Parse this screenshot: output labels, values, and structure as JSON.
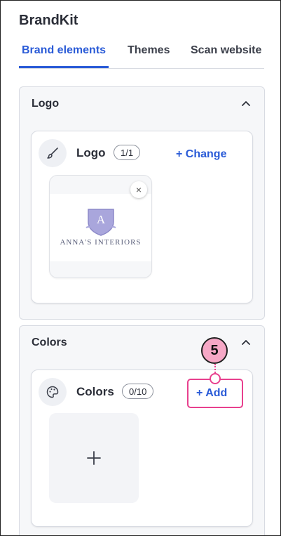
{
  "app": {
    "title": "BrandKit"
  },
  "tabs": [
    {
      "label": "Brand elements",
      "active": true
    },
    {
      "label": "Themes",
      "active": false
    },
    {
      "label": "Scan website",
      "active": false
    }
  ],
  "logo_panel": {
    "title": "Logo",
    "card": {
      "label": "Logo",
      "count": "1/1",
      "action": "+ Change",
      "logo_name": "ANNA'S INTERIORS",
      "logo_monogram": "A",
      "remove_icon": "×"
    }
  },
  "colors_panel": {
    "title": "Colors",
    "card": {
      "label": "Colors",
      "count": "0/10",
      "action": "+ Add",
      "add_tile_icon": "+"
    }
  },
  "callout": {
    "number": "5"
  },
  "colors": {
    "accent": "#2a5bd7",
    "callout": "#e8408e",
    "callout_fill": "#f6a8c6"
  }
}
